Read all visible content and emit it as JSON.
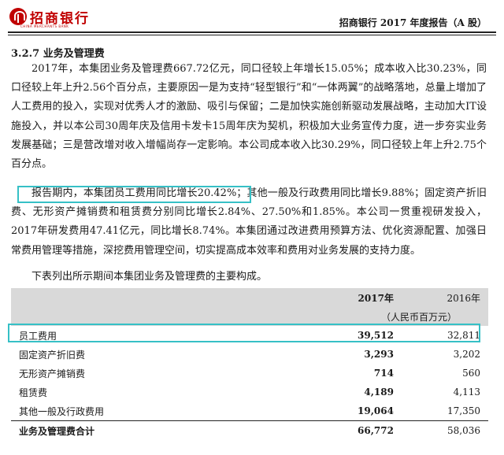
{
  "header": {
    "logo_text": "招商银行",
    "logo_sub": "CHINA MERCHANTS BANK",
    "report_title": "招商银行 2017 年度报告（A 股）"
  },
  "section_title": "3.2.7  业务及管理费",
  "paragraphs": {
    "p1": "2017年，本集团业务及管理费667.72亿元，同口径较上年增长15.05%；成本收入比30.23%，同口径较上年上升2.56个百分点，主要原因一是为支持“轻型银行”和“一体两翼”的战略落地，总量上增加了人工费用的投入，实现对优秀人才的激励、吸引与保留；二是加快实施创新驱动发展战略，主动加大IT设施投入，并以本公司30周年庆及信用卡发卡15周年庆为契机，积极加大业务宣传力度，进一步夯实业务发展基础；三是营改增对收入增幅尚存一定影响。本公司成本收入比30.29%，同口径较上年上升2.75个百分点。",
    "p2": "报告期内，本集团员工费用同比增长20.42%；其他一般及行政费用同比增长9.88%；固定资产折旧费、无形资产摊销费和租赁费分别同比增长2.84%、27.50%和1.85%。本公司一贯重视研发投入，2017年研发费用47.41亿元，同比增长8.74%。本集团通过改进费用预算方法、优化资源配置、加强日常费用管理等措施，深挖费用管理空间，切实提高成本效率和费用对业务发展的支持力度。",
    "p3": "下表列出所示期间本集团业务及管理费的主要构成。"
  },
  "table": {
    "col_2017": "2017年",
    "col_2016": "2016年",
    "unit": "（人民币百万元）",
    "rows": [
      {
        "label": "员工费用",
        "v2017": "39,512",
        "v2016": "32,811"
      },
      {
        "label": "固定资产折旧费",
        "v2017": "3,293",
        "v2016": "3,202"
      },
      {
        "label": "无形资产摊销费",
        "v2017": "714",
        "v2016": "560"
      },
      {
        "label": "租赁费",
        "v2017": "4,189",
        "v2016": "4,113"
      },
      {
        "label": "其他一般及行政费用",
        "v2017": "19,064",
        "v2016": "17,350"
      }
    ],
    "total": {
      "label": "业务及管理费合计",
      "v2017": "66,772",
      "v2016": "58,036"
    }
  },
  "colors": {
    "highlight": "#36c0c6",
    "brand": "#c00000",
    "table_header": "#d9d9d9"
  }
}
